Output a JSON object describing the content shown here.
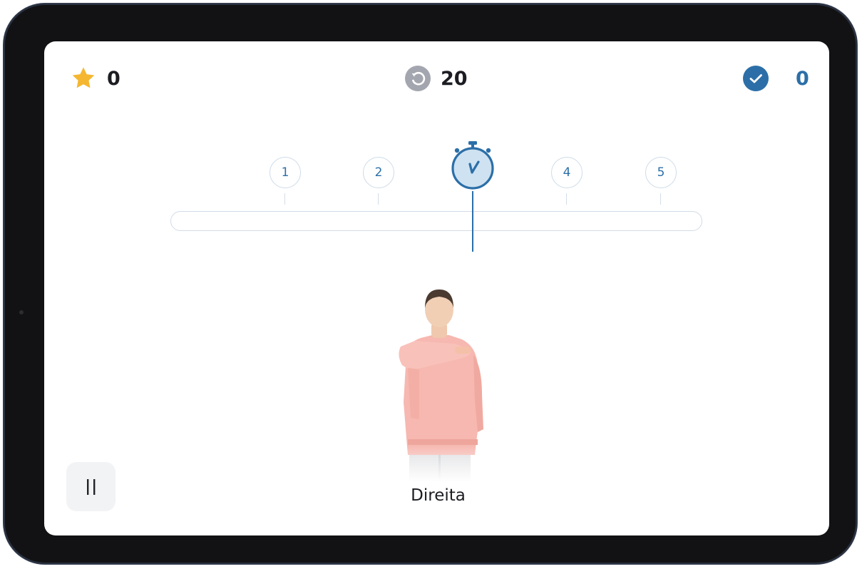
{
  "hud": {
    "stars": {
      "icon": "star-icon",
      "value": "0",
      "color": "#f5b731"
    },
    "retries": {
      "icon": "replay-icon",
      "value": "20",
      "color": "#a3a6ae"
    },
    "correct": {
      "icon": "check-circle-icon",
      "value": "0",
      "color": "#2c6fa8"
    }
  },
  "timeline": {
    "steps": [
      "1",
      "2",
      "4",
      "5"
    ],
    "current_icon": "stopwatch-icon",
    "accent": "#2c6fa8"
  },
  "exercise": {
    "image": "woman-pointing-right-photo",
    "caption": "Direita"
  },
  "controls": {
    "pause_icon": "pause-icon"
  }
}
